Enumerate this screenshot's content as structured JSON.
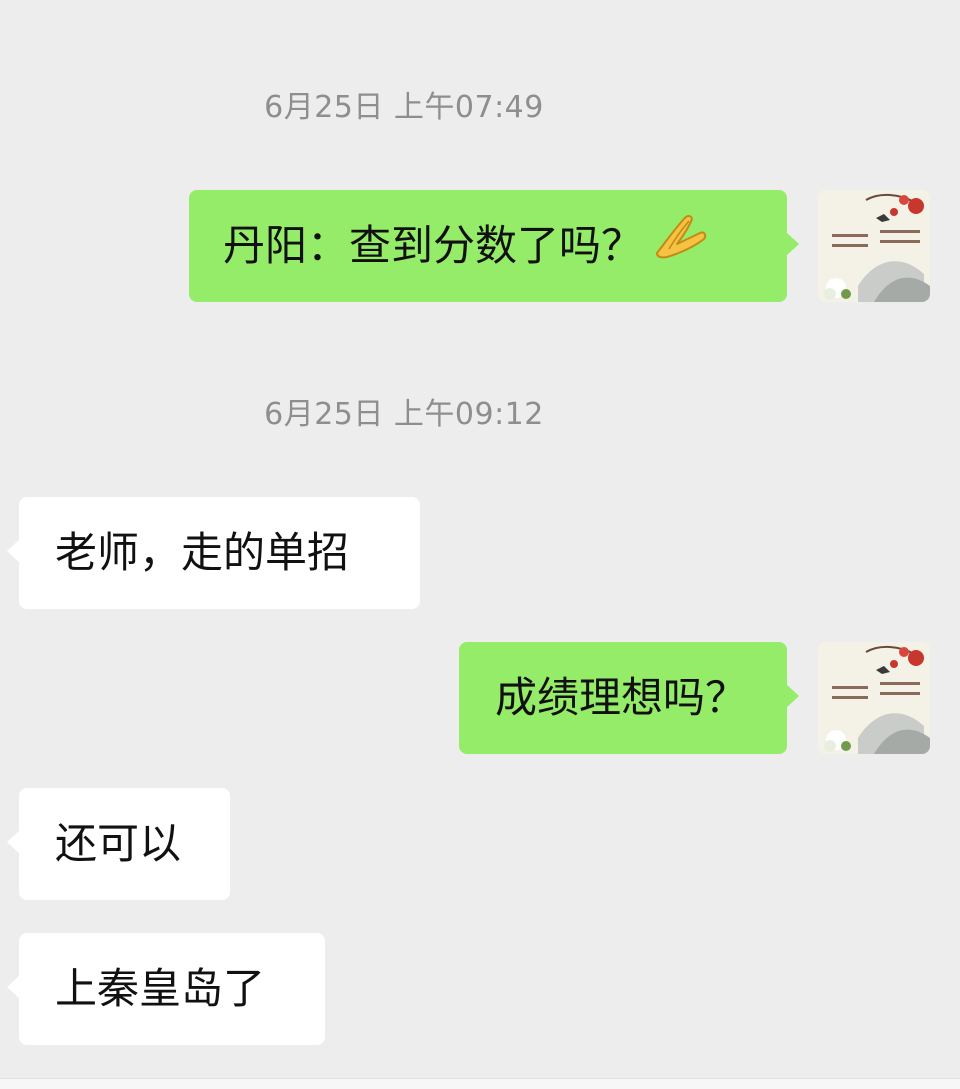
{
  "chat": {
    "timestamps": [
      "6月25日 上午07:49",
      "6月25日 上午09:12"
    ],
    "messages": [
      {
        "side": "sent",
        "text": "丹阳：查到分数了吗？",
        "emoji": "folded-hands-emoji"
      },
      {
        "side": "recv",
        "text": "老师，走的单招"
      },
      {
        "side": "sent",
        "text": "成绩理想吗？"
      },
      {
        "side": "recv",
        "text": "还可以"
      },
      {
        "side": "recv",
        "text": "上秦皇岛了"
      }
    ]
  },
  "colors": {
    "background": "#ededed",
    "sent_bubble": "#95ec69",
    "received_bubble": "#ffffff",
    "timestamp_text": "#8e8e8e"
  }
}
